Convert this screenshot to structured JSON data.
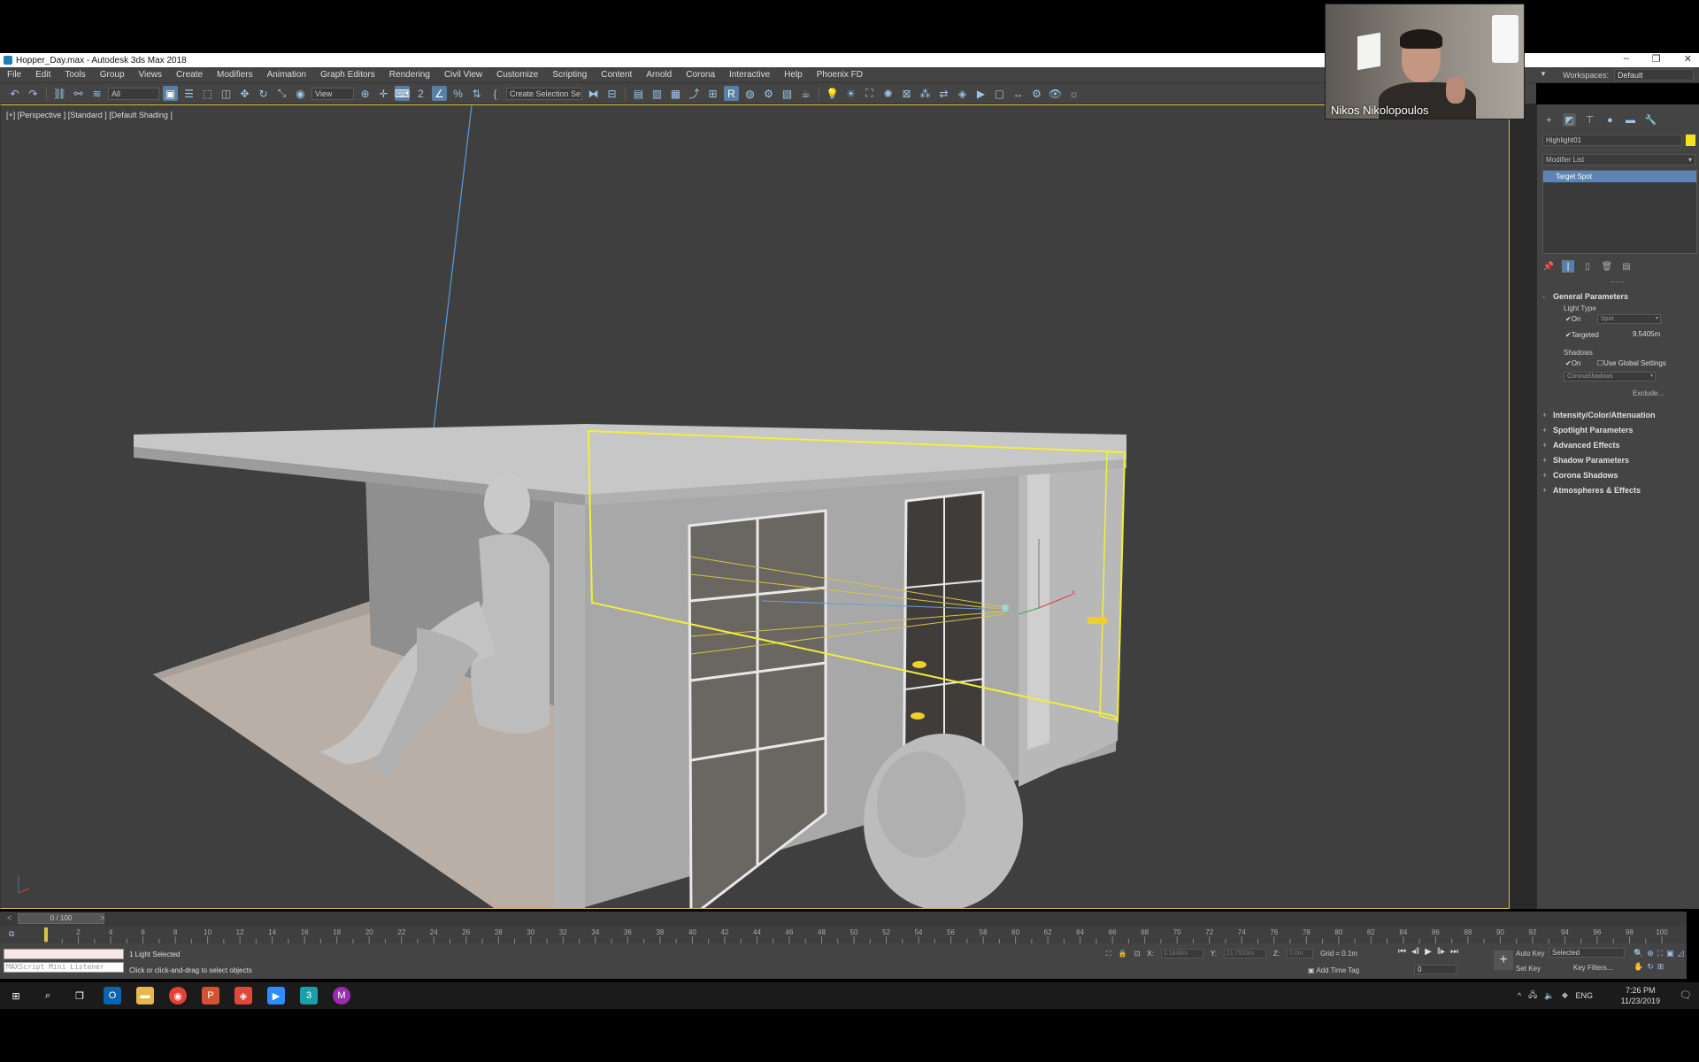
{
  "window": {
    "title": "Hopper_Day.max - Autodesk 3ds Max 2018",
    "controls": [
      "–",
      "❐",
      "✕"
    ]
  },
  "menu": {
    "items": [
      "File",
      "Edit",
      "Tools",
      "Group",
      "Views",
      "Create",
      "Modifiers",
      "Animation",
      "Graph Editors",
      "Rendering",
      "Civil View",
      "Customize",
      "Scripting",
      "Content",
      "Arnold",
      "Corona",
      "Interactive",
      "Help",
      "Phoenix FD"
    ],
    "workspaces_label": "Workspaces:",
    "workspaces_value": "Default"
  },
  "toolbar": {
    "filter_select": "All",
    "refcoord_select": "View",
    "selection_set": "Create Selection Se",
    "percent_snap": "%"
  },
  "viewport": {
    "label": "[+] [Perspective ] [Standard ] [Default Shading ]",
    "axis_z": "z",
    "axis_x": "x"
  },
  "webcam": {
    "name": "Nikos Nikolopoulos"
  },
  "command_panel": {
    "object_name": "Highlight01",
    "object_color": "#f6e21b",
    "modifier_list": "Modifier List",
    "stack_item": "Target Spot",
    "rollouts": {
      "general_parameters": "General Parameters",
      "light_type_label": "Light Type",
      "light_on": "On",
      "light_type_value": "Spot",
      "targeted": "Targeted",
      "target_distance": "9.5405m",
      "shadows_label": "Shadows",
      "shadows_on": "On",
      "use_global": "Use Global Settings",
      "shadow_type": "CoronaShadows",
      "exclude_button": "Exclude...",
      "collapsed": [
        "Intensity/Color/Attenuation",
        "Spotlight Parameters",
        "Advanced Effects",
        "Shadow Parameters",
        "Corona Shadows",
        "Atmospheres & Effects"
      ]
    }
  },
  "timeline": {
    "frame_display": "0 / 100",
    "prev": "<",
    "next": ">",
    "ticks": [
      "0",
      "2",
      "4",
      "6",
      "8",
      "10",
      "12",
      "14",
      "16",
      "18",
      "20",
      "22",
      "24",
      "26",
      "28",
      "30",
      "32",
      "34",
      "36",
      "38",
      "40",
      "42",
      "44",
      "46",
      "48",
      "50",
      "52",
      "54",
      "56",
      "58",
      "60",
      "62",
      "64",
      "66",
      "68",
      "70",
      "72",
      "74",
      "76",
      "78",
      "80",
      "82",
      "84",
      "86",
      "88",
      "90",
      "92",
      "94",
      "96",
      "98",
      "100"
    ]
  },
  "status": {
    "maxscript_placeholder": "MAXScript Mini Listener",
    "selection_status": "1 Light Selected",
    "prompt": "Click or click-and-drag to select objects",
    "x_label": "X:",
    "x_value": "3.1838m",
    "y_label": "Y:",
    "y_value": "21.7553m",
    "z_label": "Z:",
    "z_value": "0.0m",
    "grid": "Grid = 0.1m",
    "add_time_tag": "Add Time Tag",
    "frame_value": "0",
    "auto_key": "Auto Key",
    "set_key": "Set Key",
    "selected_dropdown": "Selected",
    "key_filters": "Key Filters..."
  },
  "taskbar": {
    "apps": [
      {
        "icon": "windows-start-icon",
        "color": "#1b1b1b"
      },
      {
        "icon": "search-icon",
        "color": "#1b1b1b"
      },
      {
        "icon": "task-view-icon",
        "color": "#1b1b1b"
      },
      {
        "icon": "outlook-icon",
        "color": "#0a64b0"
      },
      {
        "icon": "file-explorer-icon",
        "color": "#e8b84a"
      },
      {
        "icon": "chrome-icon",
        "color": "#e34133"
      },
      {
        "icon": "powerpoint-icon",
        "color": "#d35230"
      },
      {
        "icon": "app-red-icon",
        "color": "#e0463a"
      },
      {
        "icon": "zoom-icon",
        "color": "#2d8cff"
      },
      {
        "icon": "3dsmax-icon",
        "color": "#1d9fa8"
      },
      {
        "icon": "app-purple-icon",
        "color": "#9b2bb0"
      }
    ],
    "language": "ENG",
    "time": "7:26 PM",
    "date": "11/23/2019"
  }
}
